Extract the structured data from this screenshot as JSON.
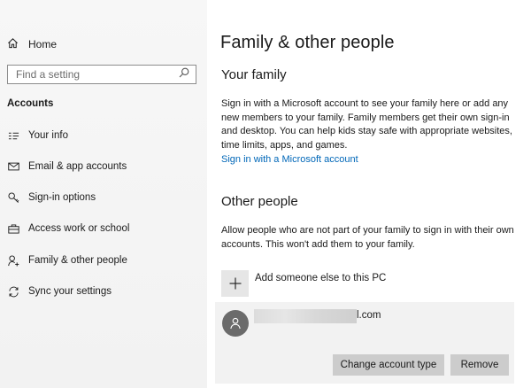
{
  "sidebar": {
    "home_label": "Home",
    "search_placeholder": "Find a setting",
    "section_title": "Accounts",
    "items": [
      {
        "label": "Your info",
        "icon": "contact-card-icon"
      },
      {
        "label": "Email & app accounts",
        "icon": "envelope-icon"
      },
      {
        "label": "Sign-in options",
        "icon": "key-icon"
      },
      {
        "label": "Access work or school",
        "icon": "briefcase-icon"
      },
      {
        "label": "Family & other people",
        "icon": "person-add-icon"
      },
      {
        "label": "Sync your settings",
        "icon": "sync-icon"
      }
    ]
  },
  "main": {
    "title": "Family & other people",
    "your_family": {
      "heading": "Your family",
      "description": "Sign in with a Microsoft account to see your family here or add any new members to your family. Family members get their own sign-in and desktop. You can help kids stay safe with appropriate websites, time limits, apps, and games.",
      "link": "Sign in with a Microsoft account"
    },
    "other_people": {
      "heading": "Other people",
      "description": "Allow people who are not part of your family to sign in with their own accounts. This won't add them to your family.",
      "add_label": "Add someone else to this PC",
      "account": {
        "email_suffix": "l.com",
        "change_button": "Change account type",
        "remove_button": "Remove"
      }
    }
  },
  "colors": {
    "link": "#0067b8",
    "sidebar_bg": "#f2f2f2",
    "button_bg": "#cccccc",
    "avatar_bg": "#6b6b6b"
  }
}
